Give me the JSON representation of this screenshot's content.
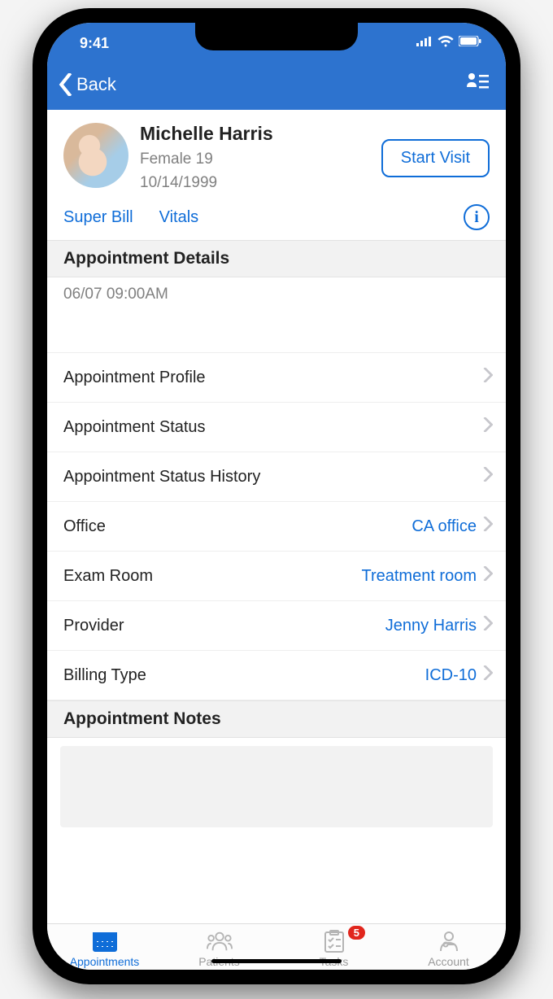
{
  "status_bar": {
    "time": "9:41"
  },
  "navbar": {
    "back_label": "Back"
  },
  "patient": {
    "name": "Michelle Harris",
    "gender_age": "Female 19",
    "dob": "10/14/1999",
    "start_visit_label": "Start Visit"
  },
  "links": {
    "super_bill": "Super Bill",
    "vitals": "Vitals",
    "info_char": "i"
  },
  "sections": {
    "details_header": "Appointment Details",
    "datetime": "06/07 09:00AM",
    "notes_header": "Appointment Notes"
  },
  "rows": [
    {
      "label": "Appointment Profile",
      "value": ""
    },
    {
      "label": "Appointment Status",
      "value": ""
    },
    {
      "label": "Appointment Status History",
      "value": ""
    },
    {
      "label": "Office",
      "value": "CA office"
    },
    {
      "label": "Exam Room",
      "value": "Treatment room"
    },
    {
      "label": "Provider",
      "value": "Jenny Harris"
    },
    {
      "label": "Billing Type",
      "value": "ICD-10"
    }
  ],
  "tabs": {
    "appointments": "Appointments",
    "patients": "Patients",
    "tasks": "Tasks",
    "tasks_badge": "5",
    "account": "Account"
  }
}
